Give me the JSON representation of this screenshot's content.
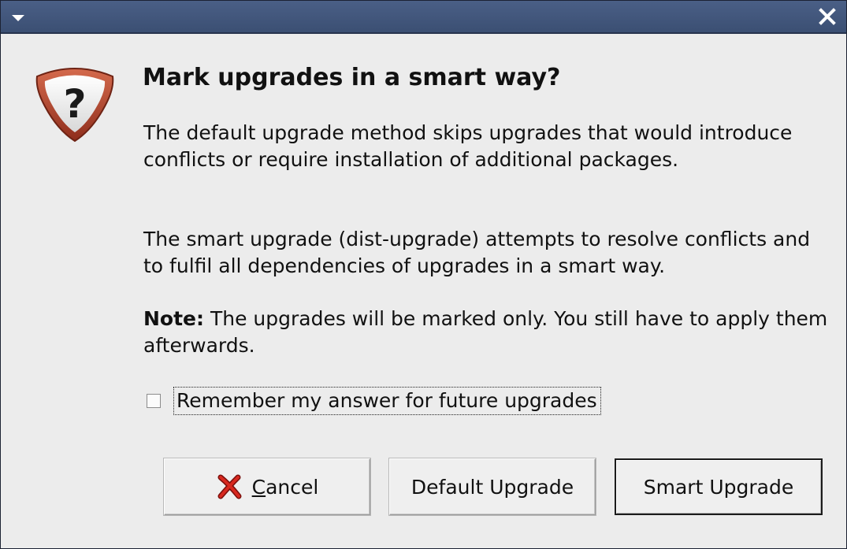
{
  "dialog": {
    "heading": "Mark upgrades in a smart way?",
    "paragraph1": "The default upgrade method skips upgrades that would introduce conflicts or require installation of additional packages.",
    "paragraph2": "The smart upgrade (dist-upgrade) attempts to resolve conflicts and to fulfil all dependencies of upgrades in a smart way.",
    "note_label": "Note:",
    "note_text": " The upgrades will be marked only. You still have to apply them afterwards.",
    "remember_label": "Remember my answer for future upgrades",
    "remember_checked": false
  },
  "buttons": {
    "cancel_mnemonic": "C",
    "cancel_rest": "ancel",
    "default_label": "Default Upgrade",
    "smart_label": "Smart Upgrade"
  },
  "icons": {
    "title_menu": "window-menu-arrow-icon",
    "close": "close-icon",
    "dialog": "question-icon",
    "cancel": "cancel-x-icon"
  },
  "colors": {
    "titlebar": "#3b4f73",
    "background": "#ececec",
    "question_icon_border": "#b0442a",
    "cancel_icon": "#c0201a"
  }
}
